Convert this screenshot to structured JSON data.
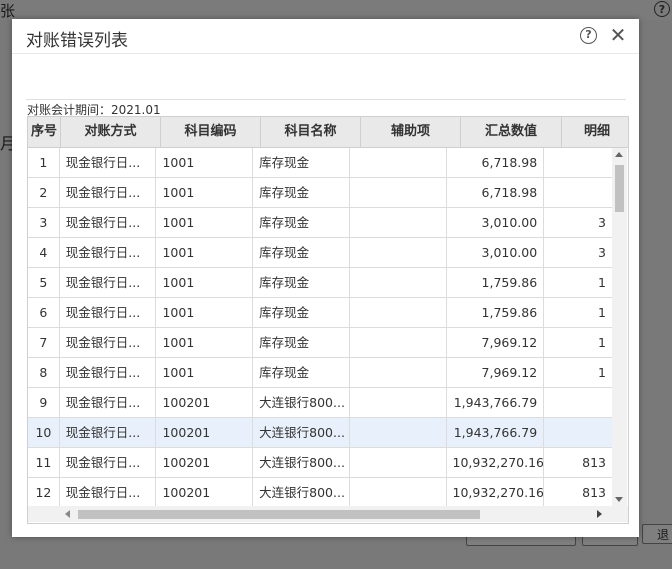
{
  "background": {
    "title_fragment": "张",
    "month_fragment": "月",
    "exit_button_fragment": "退"
  },
  "dialog": {
    "title": "对账错误列表",
    "help_icon": "question-circle-icon",
    "close_icon": "close-icon",
    "period_label": "对账会计期间：",
    "period_value": "2021.01"
  },
  "table": {
    "columns": [
      "序号",
      "对账方式",
      "科目编码",
      "科目名称",
      "辅助项",
      "汇总数值",
      "明细"
    ],
    "selected_row_index": 9,
    "rows": [
      {
        "no": "1",
        "method": "现金银行日...",
        "code": "1001",
        "name": "库存现金",
        "aux": "",
        "total": "6,718.98",
        "detail": ""
      },
      {
        "no": "2",
        "method": "现金银行日...",
        "code": "1001",
        "name": "库存现金",
        "aux": "",
        "total": "6,718.98",
        "detail": ""
      },
      {
        "no": "3",
        "method": "现金银行日...",
        "code": "1001",
        "name": "库存现金",
        "aux": "",
        "total": "3,010.00",
        "detail": "3"
      },
      {
        "no": "4",
        "method": "现金银行日...",
        "code": "1001",
        "name": "库存现金",
        "aux": "",
        "total": "3,010.00",
        "detail": "3"
      },
      {
        "no": "5",
        "method": "现金银行日...",
        "code": "1001",
        "name": "库存现金",
        "aux": "",
        "total": "1,759.86",
        "detail": "1"
      },
      {
        "no": "6",
        "method": "现金银行日...",
        "code": "1001",
        "name": "库存现金",
        "aux": "",
        "total": "1,759.86",
        "detail": "1"
      },
      {
        "no": "7",
        "method": "现金银行日...",
        "code": "1001",
        "name": "库存现金",
        "aux": "",
        "total": "7,969.12",
        "detail": "1"
      },
      {
        "no": "8",
        "method": "现金银行日...",
        "code": "1001",
        "name": "库存现金",
        "aux": "",
        "total": "7,969.12",
        "detail": "1"
      },
      {
        "no": "9",
        "method": "现金银行日...",
        "code": "100201",
        "name": "大连银行800...",
        "aux": "",
        "total": "1,943,766.79",
        "detail": ""
      },
      {
        "no": "10",
        "method": "现金银行日...",
        "code": "100201",
        "name": "大连银行800...",
        "aux": "",
        "total": "1,943,766.79",
        "detail": ""
      },
      {
        "no": "11",
        "method": "现金银行日...",
        "code": "100201",
        "name": "大连银行800...",
        "aux": "",
        "total": "10,932,270.16",
        "detail": "813"
      },
      {
        "no": "12",
        "method": "现金银行日...",
        "code": "100201",
        "name": "大连银行800...",
        "aux": "",
        "total": "10,932,270.16",
        "detail": "813"
      }
    ]
  },
  "colors": {
    "selected_row": "#e8f1fb",
    "header_bg": "#e9e9e9",
    "overlay": "#7d7d7d"
  }
}
